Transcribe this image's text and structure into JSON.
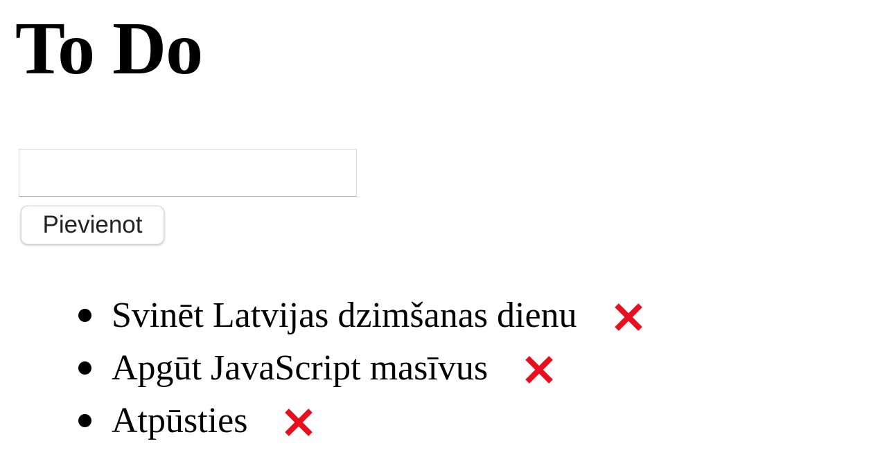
{
  "header": {
    "title": "To Do"
  },
  "form": {
    "input_value": "",
    "input_placeholder": "",
    "add_label": "Pievienot"
  },
  "todos": [
    {
      "text": "Svinēt Latvijas dzimšanas dienu",
      "delete_icon": "cross-icon"
    },
    {
      "text": "Apgūt JavaScript masīvus",
      "delete_icon": "cross-icon"
    },
    {
      "text": "Atpūsties",
      "delete_icon": "cross-icon"
    }
  ],
  "colors": {
    "delete": "#e8101e",
    "text": "#000000",
    "background": "#ffffff"
  }
}
